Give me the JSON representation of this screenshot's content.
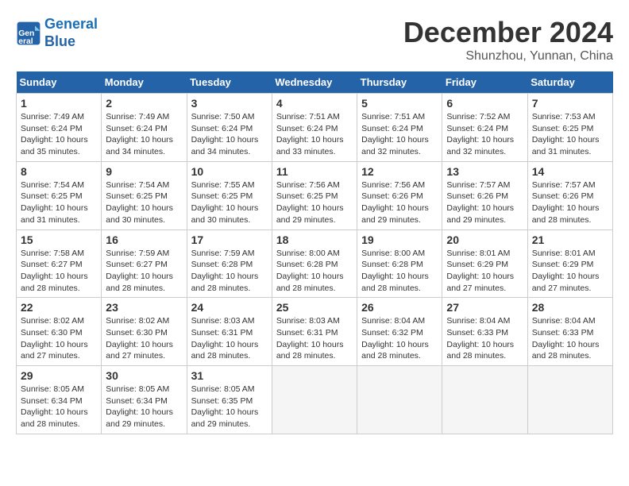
{
  "header": {
    "logo_line1": "General",
    "logo_line2": "Blue",
    "month": "December 2024",
    "location": "Shunzhou, Yunnan, China"
  },
  "weekdays": [
    "Sunday",
    "Monday",
    "Tuesday",
    "Wednesday",
    "Thursday",
    "Friday",
    "Saturday"
  ],
  "weeks": [
    [
      {
        "day": 1,
        "info": "Sunrise: 7:49 AM\nSunset: 6:24 PM\nDaylight: 10 hours\nand 35 minutes."
      },
      {
        "day": 2,
        "info": "Sunrise: 7:49 AM\nSunset: 6:24 PM\nDaylight: 10 hours\nand 34 minutes."
      },
      {
        "day": 3,
        "info": "Sunrise: 7:50 AM\nSunset: 6:24 PM\nDaylight: 10 hours\nand 34 minutes."
      },
      {
        "day": 4,
        "info": "Sunrise: 7:51 AM\nSunset: 6:24 PM\nDaylight: 10 hours\nand 33 minutes."
      },
      {
        "day": 5,
        "info": "Sunrise: 7:51 AM\nSunset: 6:24 PM\nDaylight: 10 hours\nand 32 minutes."
      },
      {
        "day": 6,
        "info": "Sunrise: 7:52 AM\nSunset: 6:24 PM\nDaylight: 10 hours\nand 32 minutes."
      },
      {
        "day": 7,
        "info": "Sunrise: 7:53 AM\nSunset: 6:25 PM\nDaylight: 10 hours\nand 31 minutes."
      }
    ],
    [
      {
        "day": 8,
        "info": "Sunrise: 7:54 AM\nSunset: 6:25 PM\nDaylight: 10 hours\nand 31 minutes."
      },
      {
        "day": 9,
        "info": "Sunrise: 7:54 AM\nSunset: 6:25 PM\nDaylight: 10 hours\nand 30 minutes."
      },
      {
        "day": 10,
        "info": "Sunrise: 7:55 AM\nSunset: 6:25 PM\nDaylight: 10 hours\nand 30 minutes."
      },
      {
        "day": 11,
        "info": "Sunrise: 7:56 AM\nSunset: 6:25 PM\nDaylight: 10 hours\nand 29 minutes."
      },
      {
        "day": 12,
        "info": "Sunrise: 7:56 AM\nSunset: 6:26 PM\nDaylight: 10 hours\nand 29 minutes."
      },
      {
        "day": 13,
        "info": "Sunrise: 7:57 AM\nSunset: 6:26 PM\nDaylight: 10 hours\nand 29 minutes."
      },
      {
        "day": 14,
        "info": "Sunrise: 7:57 AM\nSunset: 6:26 PM\nDaylight: 10 hours\nand 28 minutes."
      }
    ],
    [
      {
        "day": 15,
        "info": "Sunrise: 7:58 AM\nSunset: 6:27 PM\nDaylight: 10 hours\nand 28 minutes."
      },
      {
        "day": 16,
        "info": "Sunrise: 7:59 AM\nSunset: 6:27 PM\nDaylight: 10 hours\nand 28 minutes."
      },
      {
        "day": 17,
        "info": "Sunrise: 7:59 AM\nSunset: 6:28 PM\nDaylight: 10 hours\nand 28 minutes."
      },
      {
        "day": 18,
        "info": "Sunrise: 8:00 AM\nSunset: 6:28 PM\nDaylight: 10 hours\nand 28 minutes."
      },
      {
        "day": 19,
        "info": "Sunrise: 8:00 AM\nSunset: 6:28 PM\nDaylight: 10 hours\nand 28 minutes."
      },
      {
        "day": 20,
        "info": "Sunrise: 8:01 AM\nSunset: 6:29 PM\nDaylight: 10 hours\nand 27 minutes."
      },
      {
        "day": 21,
        "info": "Sunrise: 8:01 AM\nSunset: 6:29 PM\nDaylight: 10 hours\nand 27 minutes."
      }
    ],
    [
      {
        "day": 22,
        "info": "Sunrise: 8:02 AM\nSunset: 6:30 PM\nDaylight: 10 hours\nand 27 minutes."
      },
      {
        "day": 23,
        "info": "Sunrise: 8:02 AM\nSunset: 6:30 PM\nDaylight: 10 hours\nand 27 minutes."
      },
      {
        "day": 24,
        "info": "Sunrise: 8:03 AM\nSunset: 6:31 PM\nDaylight: 10 hours\nand 28 minutes."
      },
      {
        "day": 25,
        "info": "Sunrise: 8:03 AM\nSunset: 6:31 PM\nDaylight: 10 hours\nand 28 minutes."
      },
      {
        "day": 26,
        "info": "Sunrise: 8:04 AM\nSunset: 6:32 PM\nDaylight: 10 hours\nand 28 minutes."
      },
      {
        "day": 27,
        "info": "Sunrise: 8:04 AM\nSunset: 6:33 PM\nDaylight: 10 hours\nand 28 minutes."
      },
      {
        "day": 28,
        "info": "Sunrise: 8:04 AM\nSunset: 6:33 PM\nDaylight: 10 hours\nand 28 minutes."
      }
    ],
    [
      {
        "day": 29,
        "info": "Sunrise: 8:05 AM\nSunset: 6:34 PM\nDaylight: 10 hours\nand 28 minutes."
      },
      {
        "day": 30,
        "info": "Sunrise: 8:05 AM\nSunset: 6:34 PM\nDaylight: 10 hours\nand 29 minutes."
      },
      {
        "day": 31,
        "info": "Sunrise: 8:05 AM\nSunset: 6:35 PM\nDaylight: 10 hours\nand 29 minutes."
      },
      null,
      null,
      null,
      null
    ]
  ]
}
